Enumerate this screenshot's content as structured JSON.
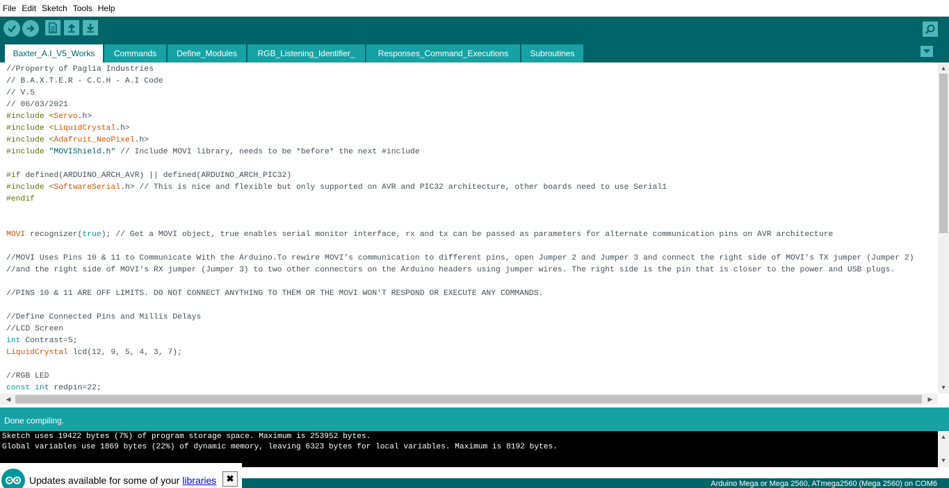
{
  "menu": [
    "File",
    "Edit",
    "Sketch",
    "Tools",
    "Help"
  ],
  "toolbar": {
    "verify_icon": "checkmark-icon",
    "upload_icon": "arrow-right-icon",
    "new_icon": "document-icon",
    "open_icon": "arrow-up-icon",
    "save_icon": "arrow-down-icon",
    "serial_icon": "magnifier-icon"
  },
  "tabs": [
    "Baxter_A.I_V5_Works",
    "Commands",
    "Define_Modules",
    "RGB_Listening_Identifier_",
    "Responses_Command_Executions",
    "Subroutines"
  ],
  "code": {
    "l1": "//Property of Paglia Industries",
    "l2": "// B.A.X.T.E.R - C.C.H - A.I Code",
    "l3": "// V.5",
    "l4": "// 06/03/2021",
    "l5a": "#include <",
    "l5b": "Servo",
    "l5c": ".h>",
    "l6a": "#include <",
    "l6b": "LiquidCrystal",
    "l6c": ".h>",
    "l7a": "#include <",
    "l7b": "Adafruit_NeoPixel",
    "l7c": ".h>",
    "l8a": "#include ",
    "l8b": "\"MOVIShield.h\"",
    "l8c": " // Include MOVI library, needs to be *before* the next #include",
    "l10a": "#if",
    "l10b": " defined(ARDUINO_ARCH_AVR) || defined(ARDUINO_ARCH_PIC32)",
    "l11a": "#include <",
    "l11b": "SoftwareSerial",
    "l11c": ".h> // This is nice and flexible but only supported on AVR and PIC32 architecture, other boards need to use Serial1",
    "l12": "#endif",
    "l15a": "MOVI",
    "l15b": " recognizer(",
    "l15c": "true",
    "l15d": "); // Get a MOVI object, true enables serial monitor interface, rx and tx can be passed as parameters for alternate communication pins on AVR architecture",
    "l17": "//MOVI Uses Pins 10 & 11 to Communicate With the Arduino.To rewire MOVI’s communication to different pins, open Jumper 2 and Jumper 3 and connect the right side of MOVI's TX jumper (Jumper 2)",
    "l18": "//and the right side of MOVI's RX jumper (Jumper 3) to two other connectors on the Arduino headers using jumper wires. The right side is the pin that is closer to the power and USB plugs.",
    "l20": "//PINS 10 & 11 ARE OFF LIMITS. DO NOT CONNECT ANYTHING TO THEM OR THE MOVI WON'T RESPOND OR EXECUTE ANY COMMANDS.",
    "l22": "//Define Connected Pins and Millis Delays",
    "l23": "//LCD Screen",
    "l24a": "int",
    "l24b": " Contrast=5;",
    "l25a": "LiquidCrystal",
    "l25b": " lcd(12, 9, 5, 4, 3, 7);",
    "l27": "//RGB LED",
    "l28a": "const",
    "l28b": " ",
    "l28c": "int",
    "l28d": " redpin=22;"
  },
  "status": "Done compiling.",
  "console": [
    "Sketch uses 19422 bytes (7%) of program storage space. Maximum is 253952 bytes.",
    "Global variables use 1869 bytes (22%) of dynamic memory, leaving 6323 bytes for local variables. Maximum is 8192 bytes."
  ],
  "notification": {
    "text": "Updates available for some of your ",
    "link": "libraries",
    "close_glyph": "✖",
    "logo_icon": "arduino-logo-icon"
  },
  "board": "Arduino Mega or Mega 2560, ATmega2560 (Mega 2560) on COM6",
  "scroll_arrows": {
    "up": "▲",
    "down": "▼",
    "left": "◀",
    "right": "▶"
  }
}
